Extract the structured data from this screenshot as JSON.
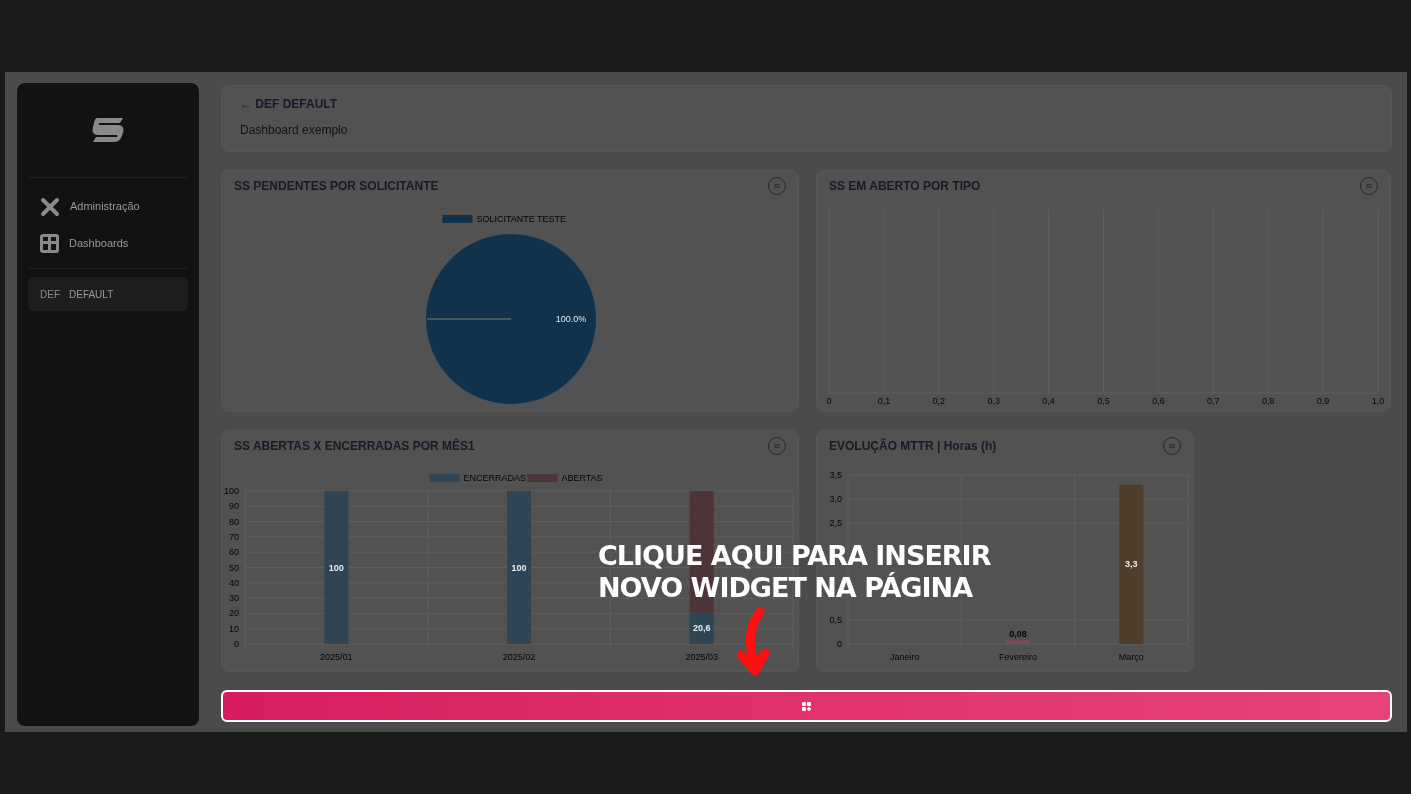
{
  "sidebar": {
    "nav_items": [
      {
        "label": "Administração",
        "kind": "tools"
      },
      {
        "label": "Dashboards",
        "kind": "dashboards"
      }
    ],
    "dashboards": [
      {
        "code": "DEF",
        "label": "DEFAULT",
        "selected": true
      }
    ]
  },
  "header": {
    "title": "← DEF DEFAULT",
    "subtitle": "Dashboard exemplo"
  },
  "widgets": [
    {
      "title": "SS PENDENTES POR SOLICITANTE",
      "chart_data": {
        "type": "pie",
        "categories": [
          "SOLICITANTE TESTE"
        ],
        "values": [
          100
        ],
        "colors": [
          "#10324c"
        ],
        "value_labels": [
          "100.0%"
        ],
        "legend": true,
        "needle": "SOLICITANTE TESTE"
      }
    },
    {
      "title": "SS EM ABERTO POR TIPO",
      "chart_data": {
        "type": "bar",
        "orientation": "horizontal",
        "categories": [
          null
        ],
        "grid": true,
        "xlim": [
          0,
          1
        ],
        "xticks": [
          {
            "value": 0,
            "label": "0"
          },
          {
            "value": 0.1,
            "label": "0,1"
          },
          {
            "value": 0.2,
            "label": "0,2"
          },
          {
            "value": 0.3,
            "label": "0,3"
          },
          {
            "value": 0.4,
            "label": "0,4"
          },
          {
            "value": 0.5,
            "label": "0,5"
          },
          {
            "value": 0.6,
            "label": "0,6"
          },
          {
            "value": 0.7,
            "label": "0,7"
          },
          {
            "value": 0.8,
            "label": "0,8"
          },
          {
            "value": 0.9,
            "label": "0,9"
          },
          {
            "value": 1,
            "label": "1,0"
          }
        ]
      }
    },
    {
      "title": "SS ABERTAS X ENCERRADAS POR MÊS1",
      "chart_data": {
        "type": "bar",
        "stacked": true,
        "grid": true,
        "legend": true,
        "categories": [
          "2025/01",
          "2025/02",
          "2025/03"
        ],
        "ylim": [
          0,
          100
        ],
        "yticks": [
          0,
          10,
          20,
          30,
          40,
          50,
          60,
          70,
          80,
          90,
          100
        ],
        "series": [
          {
            "name": "ENCERRADAS",
            "color": "#2f4556",
            "values": [
              100,
              100,
              20.6
            ],
            "value_labels": [
              "100",
              "100",
              "20,6"
            ]
          },
          {
            "name": "ABERTAS",
            "color": "#4d3439",
            "values": [
              null,
              null,
              79.4
            ]
          }
        ]
      }
    },
    {
      "title": "EVOLUÇÃO MTTR | Horas (h)",
      "chart_data": {
        "type": "bar",
        "grid": true,
        "categories": [
          "Janeiro",
          "Fevereiro",
          "Março"
        ],
        "ylim": [
          0,
          3.5
        ],
        "yticks": [
          {
            "value": 0,
            "label": "0"
          },
          {
            "value": 0.5,
            "label": "0,5"
          },
          {
            "value": 2.5,
            "label": "2,5"
          },
          {
            "value": 3,
            "label": "3,0"
          },
          {
            "value": 3.5,
            "label": "3,5"
          }
        ],
        "values": [
          null,
          0.08,
          3.3
        ],
        "colors": [
          null,
          "#7a4a55",
          "#4f3e2c"
        ],
        "value_labels": [
          null,
          "0,08",
          "3,3"
        ]
      }
    }
  ],
  "tutorial": {
    "lines": [
      "CLIQUE AQUI PARA INSERIR",
      "NOVO WIDGET NA PÁGINA"
    ]
  }
}
